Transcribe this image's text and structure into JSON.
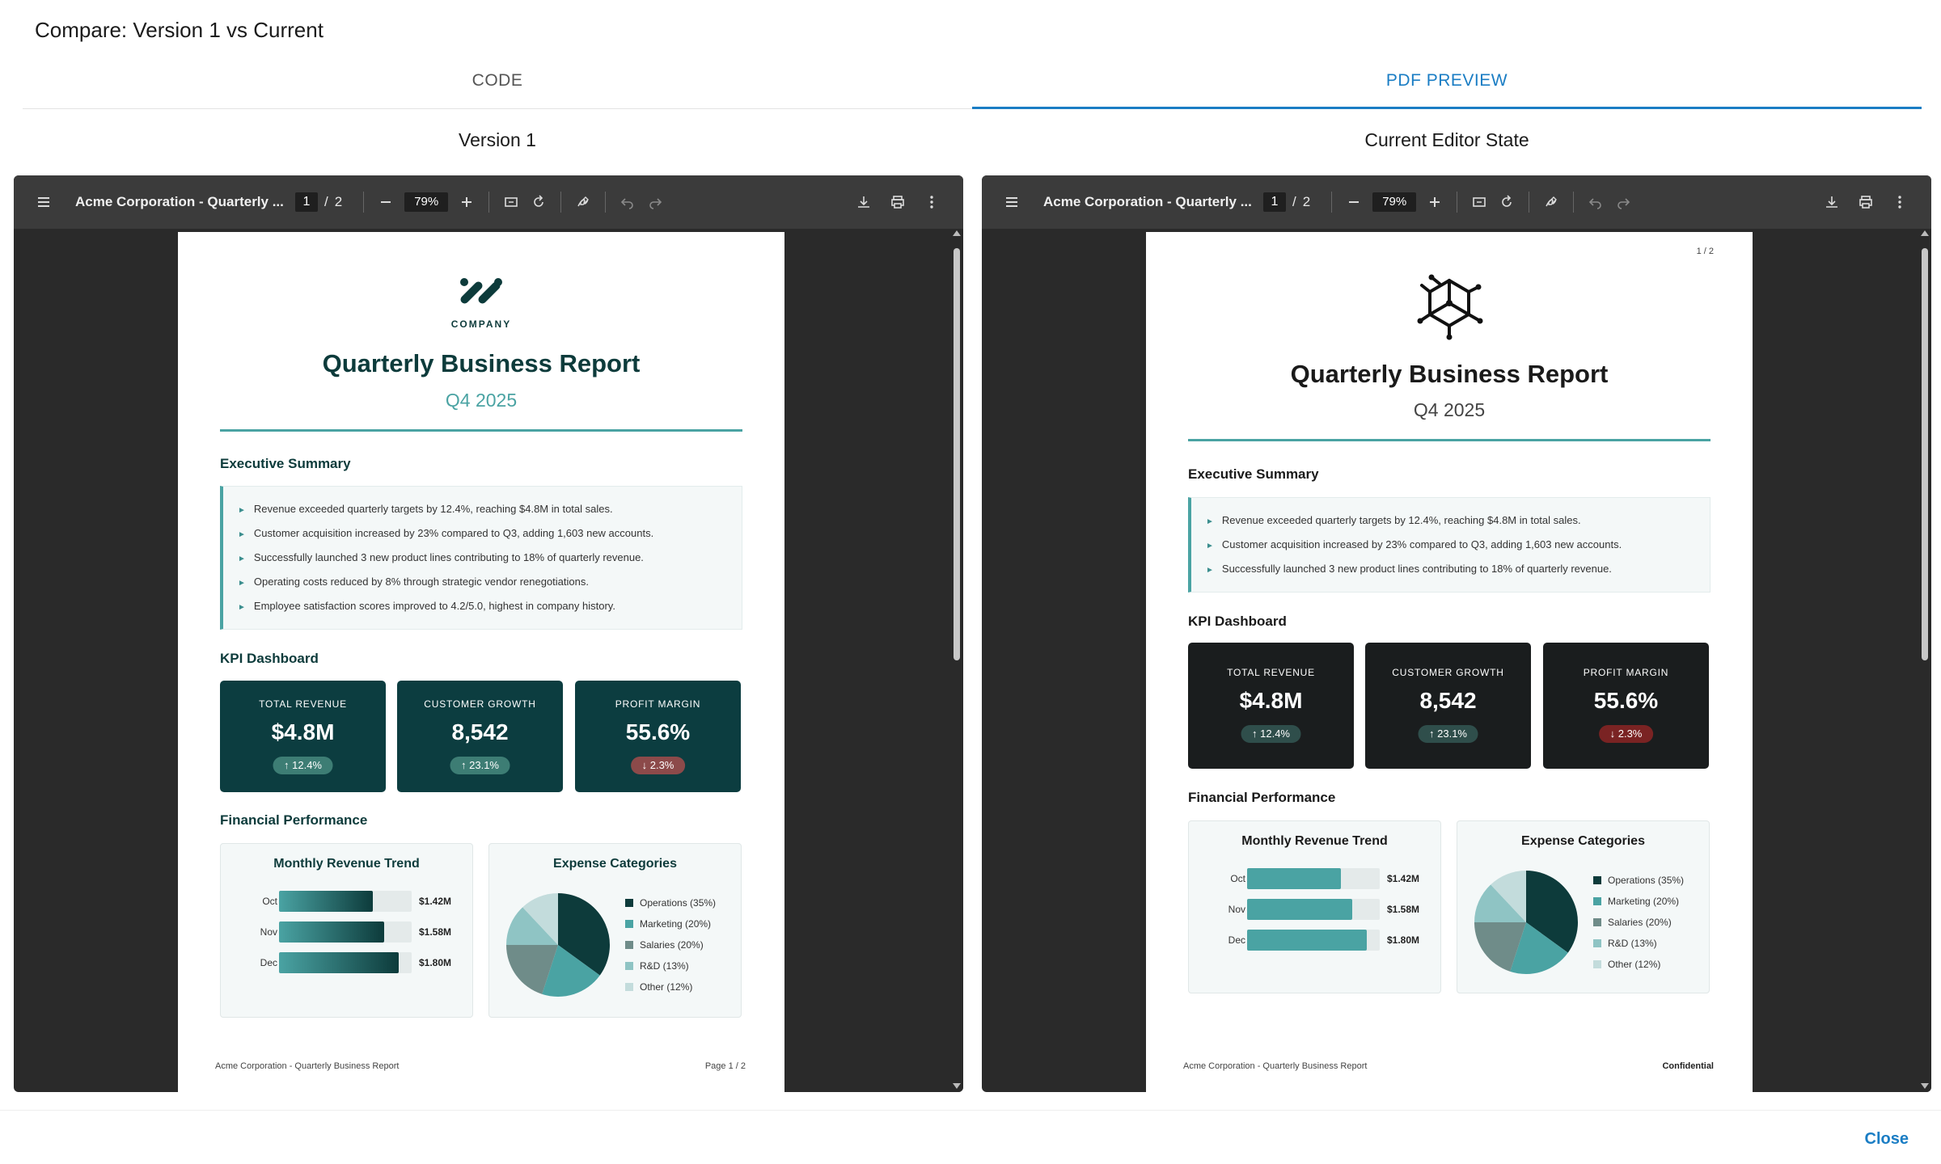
{
  "dialog": {
    "title": "Compare: Version 1 vs Current",
    "tabs": [
      {
        "label": "CODE"
      },
      {
        "label": "PDF PREVIEW"
      }
    ],
    "close_label": "Close"
  },
  "toolbar": {
    "doc_title": "Acme Corporation - Quarterly ...",
    "page_current": "1",
    "page_sep": "/",
    "page_total": "2",
    "zoom": "79%"
  },
  "left": {
    "label": "Version 1",
    "report": {
      "company": "COMPANY",
      "title": "Quarterly Business Report",
      "subtitle": "Q4 2025",
      "exec_heading": "Executive Summary",
      "exec_items": [
        "Revenue exceeded quarterly targets by 12.4%, reaching $4.8M in total sales.",
        "Customer acquisition increased by 23% compared to Q3, adding 1,603 new accounts.",
        "Successfully launched 3 new product lines contributing to 18% of quarterly revenue.",
        "Operating costs reduced by 8% through strategic vendor renegotiations.",
        "Employee satisfaction scores improved to 4.2/5.0, highest in company history."
      ],
      "kpi_heading": "KPI Dashboard",
      "kpis": [
        {
          "label": "TOTAL REVENUE",
          "value": "$4.8M",
          "change": "↑ 12.4%",
          "trend": "up"
        },
        {
          "label": "CUSTOMER GROWTH",
          "value": "8,542",
          "change": "↑ 23.1%",
          "trend": "up"
        },
        {
          "label": "PROFIT MARGIN",
          "value": "55.6%",
          "change": "↓ 2.3%",
          "trend": "down"
        }
      ],
      "fin_heading": "Financial Performance",
      "footer_left": "Acme Corporation - Quarterly Business Report",
      "footer_right": "Page 1 / 2"
    },
    "colors": {
      "primary": "#0d3b3b",
      "accent": "#4aa3a3",
      "kpi_bg": "#0c3d40",
      "up_pill": "#3d7d74",
      "down_pill": "#8c4a4a"
    }
  },
  "right": {
    "label": "Current Editor State",
    "report": {
      "page_indicator": "1 / 2",
      "title": "Quarterly Business Report",
      "subtitle": "Q4 2025",
      "exec_heading": "Executive Summary",
      "exec_items": [
        "Revenue exceeded quarterly targets by 12.4%, reaching $4.8M in total sales.",
        "Customer acquisition increased by 23% compared to Q3, adding 1,603 new accounts.",
        "Successfully launched 3 new product lines contributing to 18% of quarterly revenue."
      ],
      "kpi_heading": "KPI Dashboard",
      "kpis": [
        {
          "label": "TOTAL REVENUE",
          "value": "$4.8M",
          "change": "↑ 12.4%",
          "trend": "up"
        },
        {
          "label": "CUSTOMER GROWTH",
          "value": "8,542",
          "change": "↑ 23.1%",
          "trend": "up"
        },
        {
          "label": "PROFIT MARGIN",
          "value": "55.6%",
          "change": "↓ 2.3%",
          "trend": "down"
        }
      ],
      "fin_heading": "Financial Performance",
      "footer_left": "Acme Corporation - Quarterly Business Report",
      "footer_right": "Confidential"
    },
    "colors": {
      "primary": "#1a1a1a",
      "accent": "#4aa3a3",
      "kpi_bg": "#1a1d1e",
      "up_pill": "#2f4e4b",
      "down_pill": "#7a2323"
    }
  },
  "chart_data": [
    {
      "type": "bar",
      "title": "Monthly Revenue Trend",
      "orientation": "horizontal",
      "categories": [
        "Oct",
        "Nov",
        "Dec"
      ],
      "values": [
        1.42,
        1.58,
        1.8
      ],
      "value_labels": [
        "$1.42M",
        "$1.58M",
        "$1.80M"
      ],
      "xlim": [
        0,
        2.0
      ]
    },
    {
      "type": "pie",
      "title": "Expense Categories",
      "labels": [
        "Operations (35%)",
        "Marketing (20%)",
        "Salaries (20%)",
        "R&D (13%)",
        "Other (12%)"
      ],
      "values": [
        35,
        20,
        20,
        13,
        12
      ],
      "colors": [
        "#0d3b3b",
        "#4aa3a3",
        "#6f8c89",
        "#8fc4c4",
        "#c3dcdc"
      ],
      "colors_right": [
        "#0d3b3b",
        "#4aa3a3",
        "#6f8c89",
        "#8fc4c4",
        "#c3dcdc"
      ]
    }
  ]
}
